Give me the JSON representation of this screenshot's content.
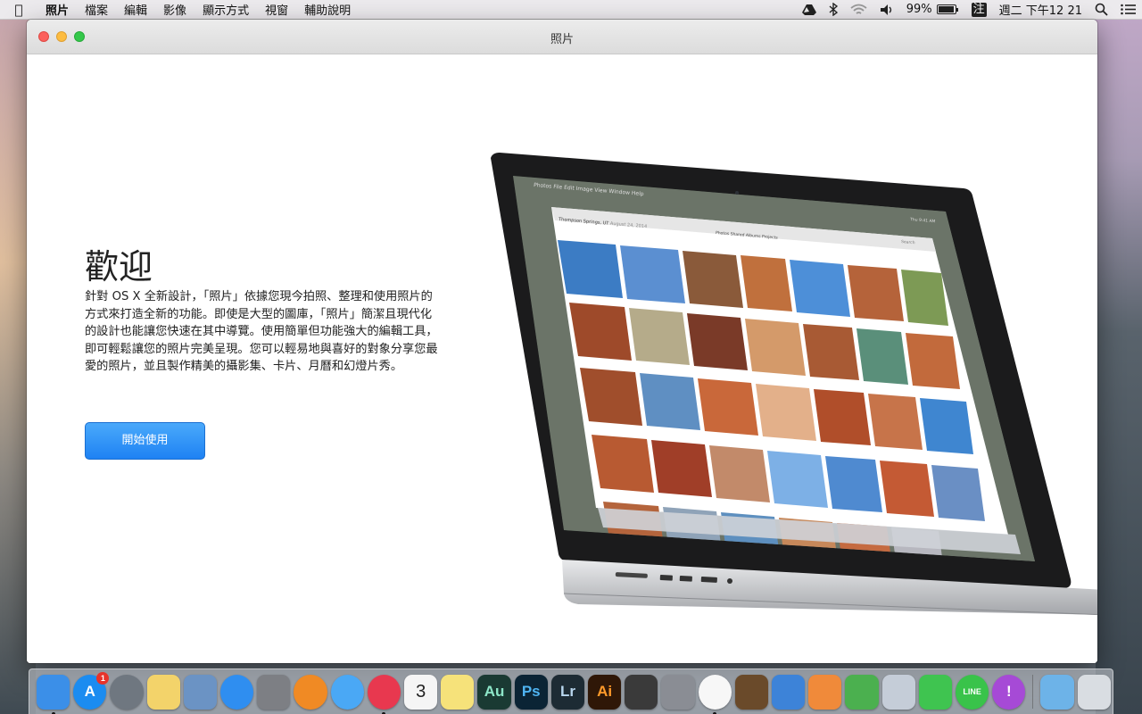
{
  "menubar": {
    "apple": "",
    "app_name": "照片",
    "items": [
      "檔案",
      "編輯",
      "影像",
      "顯示方式",
      "視窗",
      "輔助說明"
    ],
    "battery": "99%",
    "input_method": "注",
    "clock": "週二 下午12 21"
  },
  "window": {
    "title": "照片"
  },
  "welcome": {
    "title": "歡迎",
    "body": "針對 OS X 全新設計，「照片」依據您現今拍照、整理和使用照片的方式來打造全新的功能。即使是大型的圖庫，「照片」簡潔且現代化的設計也能讓您快速在其中導覽。使用簡單但功能強大的編輯工具，即可輕鬆讓您的照片完美呈現。您可以輕易地與喜好的對象分享您最愛的照片，並且製作精美的攝影集、卡片、月曆和幻燈片秀。",
    "start_button": "開始使用"
  },
  "illustration": {
    "menu": [
      "Photos",
      "File",
      "Edit",
      "Image",
      "View",
      "Window",
      "Help"
    ],
    "location": "Thompson Springs, UT",
    "date": "August 24, 2014",
    "tabs": [
      "Photos",
      "Shared",
      "Albums",
      "Projects"
    ],
    "clock": "Thu 9:41 AM",
    "search_placeholder": "Search"
  },
  "dock": {
    "items": [
      {
        "name": "finder",
        "label": "",
        "color": "#3b8fe8",
        "running": true
      },
      {
        "name": "app-store",
        "label": "A",
        "color": "#1b8cf0",
        "running": false,
        "badge": "1"
      },
      {
        "name": "launchpad",
        "label": "",
        "color": "#6f7780",
        "running": false
      },
      {
        "name": "stickies",
        "label": "",
        "color": "#f3d36a",
        "running": false
      },
      {
        "name": "preview",
        "label": "",
        "color": "#6b93c4",
        "running": false
      },
      {
        "name": "safari",
        "label": "",
        "color": "#2f8ef0",
        "running": false
      },
      {
        "name": "system-preferences",
        "label": "",
        "color": "#7d7f84",
        "running": false
      },
      {
        "name": "ibooks",
        "label": "",
        "color": "#f08a24",
        "running": false
      },
      {
        "name": "messages",
        "label": "",
        "color": "#4aa8f5",
        "running": false
      },
      {
        "name": "itunes",
        "label": "",
        "color": "#e8384f",
        "running": true
      },
      {
        "name": "calendar",
        "label": "3",
        "color": "#f5f5f5",
        "running": false
      },
      {
        "name": "notes",
        "label": "",
        "color": "#f6e27a",
        "running": false
      },
      {
        "name": "audition",
        "label": "Au",
        "color": "#1a3a33",
        "running": false
      },
      {
        "name": "photoshop",
        "label": "Ps",
        "color": "#0b2435",
        "running": false
      },
      {
        "name": "lightroom",
        "label": "Lr",
        "color": "#1d2b34",
        "running": false
      },
      {
        "name": "illustrator",
        "label": "Ai",
        "color": "#2f1707",
        "running": false
      },
      {
        "name": "final-cut-pro",
        "label": "",
        "color": "#3a3a3a",
        "running": false
      },
      {
        "name": "motion",
        "label": "",
        "color": "#8a8d94",
        "running": false
      },
      {
        "name": "photos",
        "label": "",
        "color": "#f7f7f7",
        "running": true
      },
      {
        "name": "garageband",
        "label": "",
        "color": "#6a4a2a",
        "running": false
      },
      {
        "name": "keynote",
        "label": "",
        "color": "#3d83d8",
        "running": false
      },
      {
        "name": "pages",
        "label": "",
        "color": "#f08a3a",
        "running": false
      },
      {
        "name": "numbers",
        "label": "",
        "color": "#4bb04f",
        "running": false
      },
      {
        "name": "preview-2",
        "label": "",
        "color": "#c5cdd8",
        "running": false
      },
      {
        "name": "facetime",
        "label": "",
        "color": "#3fc450",
        "running": false
      },
      {
        "name": "line",
        "label": "LINE",
        "color": "#39c34a",
        "running": false
      },
      {
        "name": "podcast",
        "label": "!",
        "color": "#a64ad6",
        "running": false
      }
    ],
    "trailing": [
      {
        "name": "downloads",
        "label": "",
        "color": "#6db3e8"
      },
      {
        "name": "trash",
        "label": "",
        "color": "#d9dde2"
      }
    ]
  }
}
